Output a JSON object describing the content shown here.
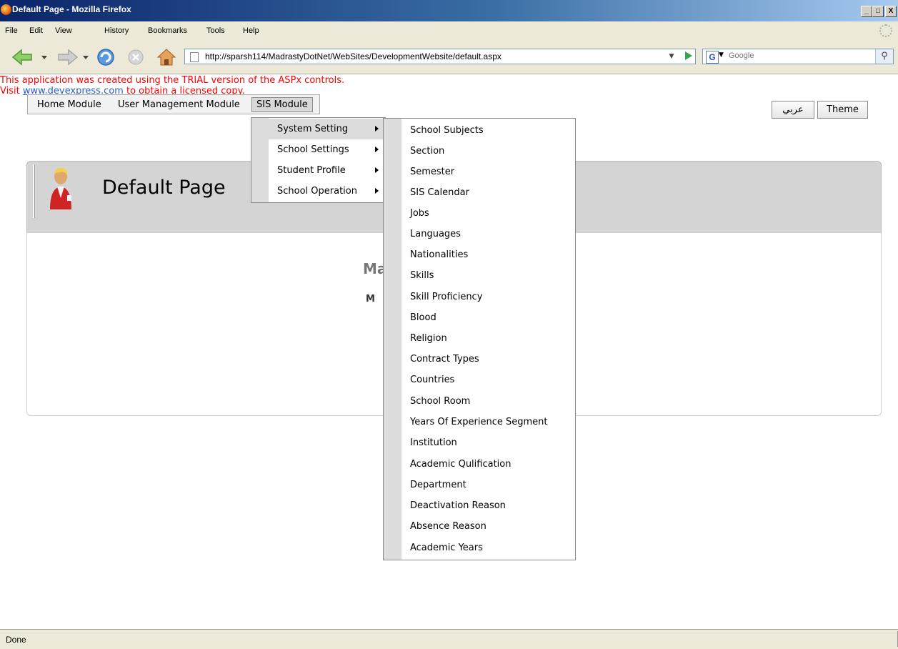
{
  "window": {
    "title": "Default Page - Mozilla Firefox",
    "controls": {
      "minimize": "_",
      "maximize": "□",
      "close": "X"
    }
  },
  "browser_menu": [
    "File",
    "Edit",
    "View",
    "History",
    "Bookmarks",
    "Tools",
    "Help"
  ],
  "nav": {
    "url": "http://sparsh114/MadrastyDotNet/WebSites/DevelopmentWebsite/default.aspx",
    "search_engine_letter": "G",
    "search_placeholder": "Google"
  },
  "trial_notice": {
    "line1": "This application was created using the TRIAL version of the ASPx controls.",
    "line2_prefix": "Visit ",
    "link": "www.devexpress.com",
    "line2_suffix": " to obtain a licensed copy."
  },
  "app_menu": {
    "items": [
      "Home Module",
      "User Management Module",
      "SIS Module"
    ],
    "selected": "SIS Module"
  },
  "buttons": {
    "arabic": "عربي",
    "theme": "Theme"
  },
  "page": {
    "title": "Default Page",
    "welcome_partial": "Ma",
    "welcome_sub_partial": "M"
  },
  "sis_submenu": {
    "items": [
      "System Setting",
      "School Settings",
      "Student Profile",
      "School Operation"
    ],
    "highlighted": "System Setting"
  },
  "system_setting_submenu": {
    "items": [
      "School Subjects",
      "Section",
      "Semester",
      "SIS Calendar",
      "Jobs",
      "Languages",
      "Nationalities",
      "Skills",
      "Skill Proficiency",
      "Blood",
      "Religion",
      "Contract Types",
      "Countries",
      "School Room",
      "Years Of Experience Segment",
      "Institution",
      "Academic Qulification",
      "Department",
      "Deactivation Reason",
      "Absence Reason",
      "Academic Years"
    ]
  },
  "status": {
    "text": "Done"
  }
}
